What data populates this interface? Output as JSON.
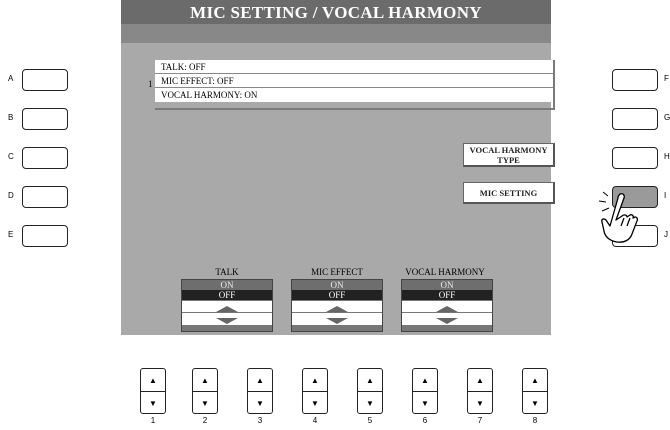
{
  "screen": {
    "title": "MIC SETTING / VOCAL HARMONY",
    "list": {
      "number": "1",
      "rows": [
        "TALK: OFF",
        "MIC EFFECT: OFF",
        "VOCAL HARMONY: ON"
      ]
    },
    "right_buttons": {
      "vocal_harmony_type": {
        "line1": "VOCAL HARMONY",
        "line2": "TYPE"
      },
      "mic_setting": "MIC SETTING"
    },
    "columns": [
      {
        "label": "TALK",
        "on": "ON",
        "off": "OFF",
        "selected": "OFF"
      },
      {
        "label": "MIC EFFECT",
        "on": "ON",
        "off": "OFF",
        "selected": "OFF"
      },
      {
        "label": "VOCAL HARMONY",
        "on": "ON",
        "off": "OFF",
        "selected": "ON"
      }
    ]
  },
  "left_buttons": [
    "A",
    "B",
    "C",
    "D",
    "E"
  ],
  "right_hardware_buttons": [
    "F",
    "G",
    "H",
    "I",
    "J"
  ],
  "pressed_button": "I",
  "bottom_buttons": [
    "1",
    "2",
    "3",
    "4",
    "5",
    "6",
    "7",
    "8"
  ],
  "icons": {
    "up": "up-triangle",
    "down": "down-triangle",
    "pointer": "pointing-hand"
  }
}
